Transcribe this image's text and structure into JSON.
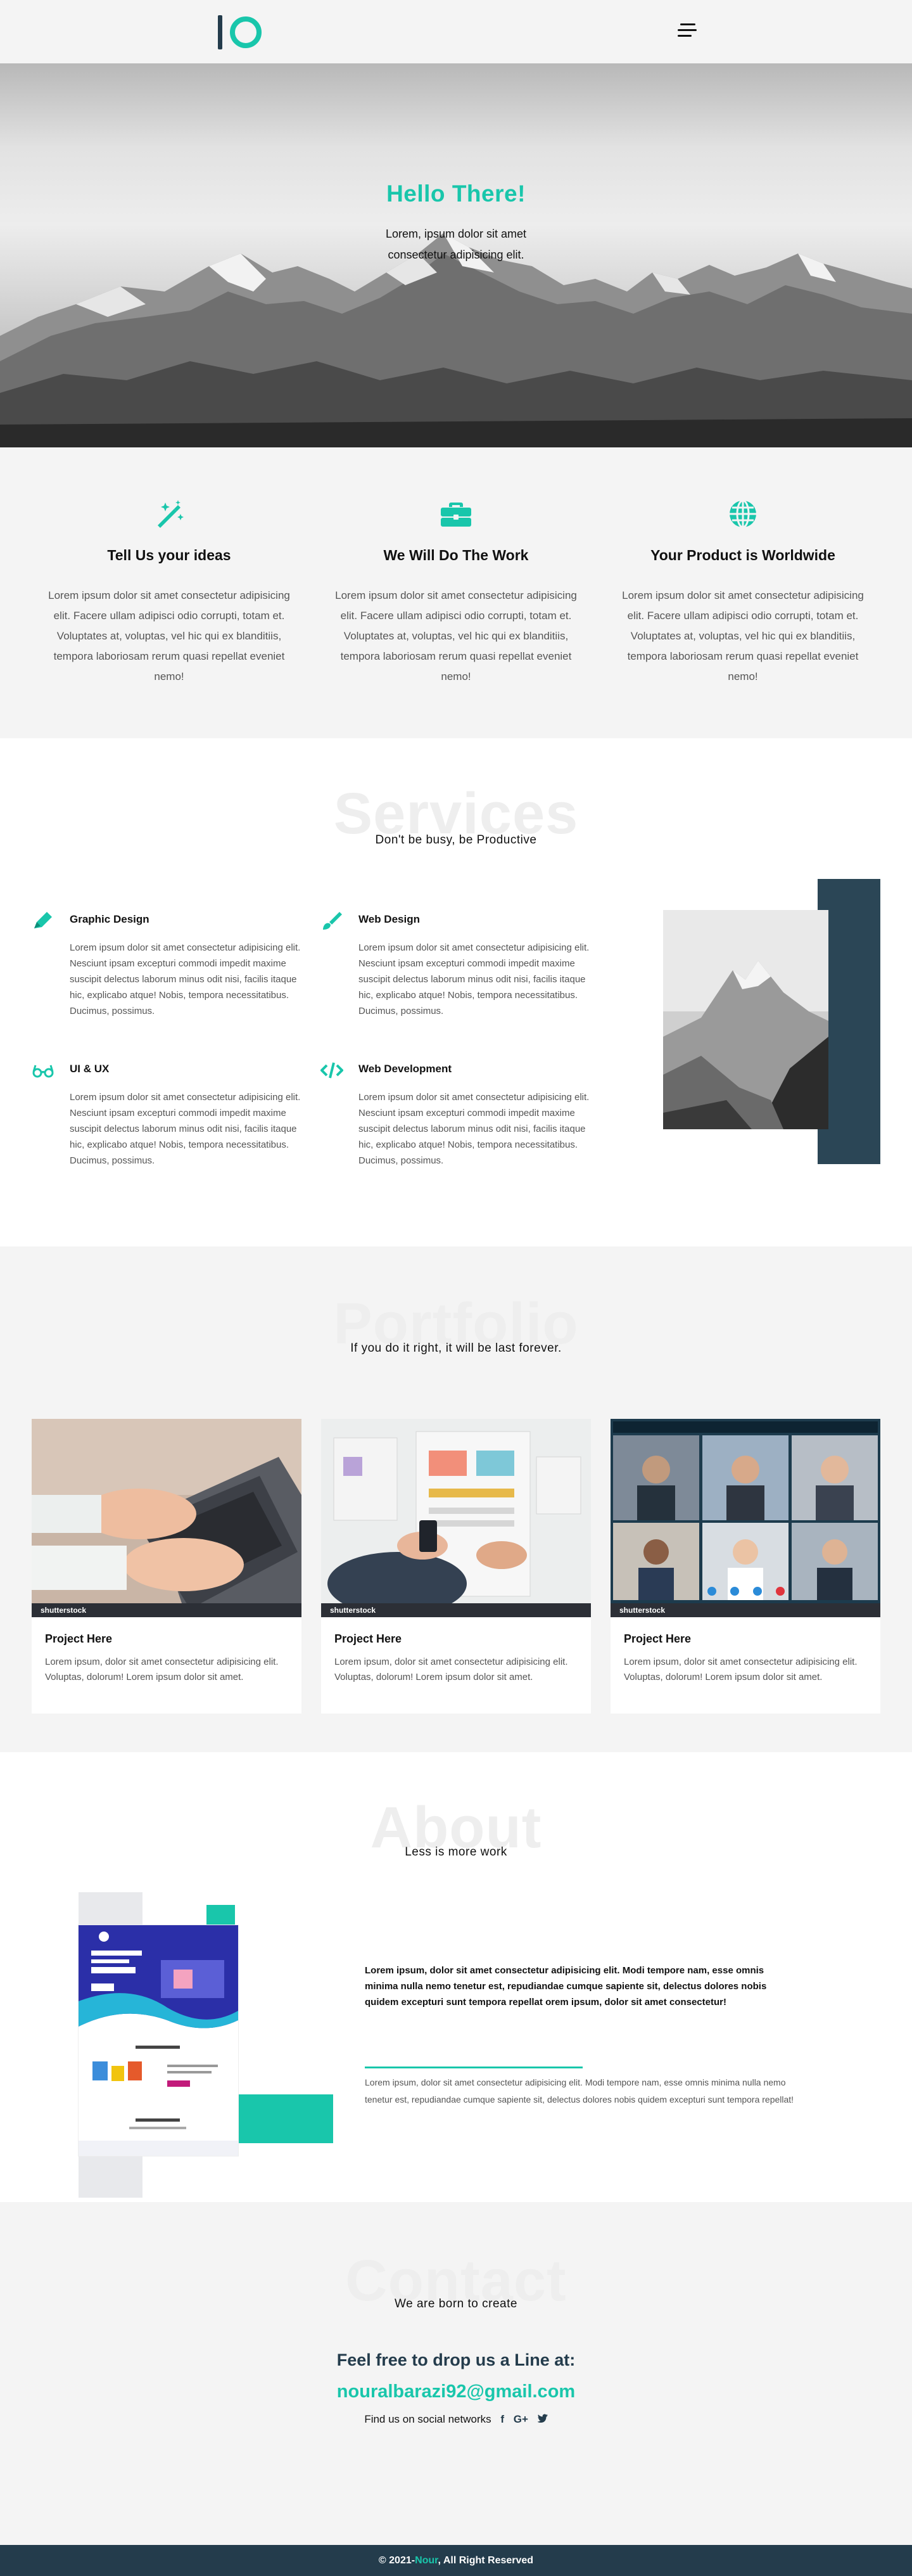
{
  "colors": {
    "accent": "#19c6ab",
    "dark": "#243c4c",
    "light_bg": "#f4f4f4"
  },
  "header": {
    "menu_icon": "hamburger-menu-icon"
  },
  "hero": {
    "title": "Hello There!",
    "subtitle": "Lorem, ipsum dolor sit amet consectetur adipisicing elit."
  },
  "features": [
    {
      "icon": "magic-wand-icon",
      "title": "Tell Us your ideas",
      "text": "Lorem ipsum dolor sit amet consectetur adipisicing elit. Facere ullam adipisci odio corrupti, totam et. Voluptates at, voluptas, vel hic qui ex blanditiis, tempora laboriosam rerum quasi repellat eveniet nemo!"
    },
    {
      "icon": "briefcase-icon",
      "title": "We Will Do The Work",
      "text": "Lorem ipsum dolor sit amet consectetur adipisicing elit. Facere ullam adipisci odio corrupti, totam et. Voluptates at, voluptas, vel hic qui ex blanditiis, tempora laboriosam rerum quasi repellat eveniet nemo!"
    },
    {
      "icon": "globe-icon",
      "title": "Your Product is Worldwide",
      "text": "Lorem ipsum dolor sit amet consectetur adipisicing elit. Facere ullam adipisci odio corrupti, totam et. Voluptates at, voluptas, vel hic qui ex blanditiis, tempora laboriosam rerum quasi repellat eveniet nemo!"
    }
  ],
  "services": {
    "heading": "Services",
    "subtitle": "Don't be busy, be Productive",
    "items": [
      {
        "icon": "pencil-icon",
        "title": "Graphic Design",
        "text": "Lorem ipsum dolor sit amet consectetur adipisicing elit. Nesciunt ipsam excepturi commodi impedit maxime suscipit delectus laborum minus odit nisi, facilis itaque hic, explicabo atque! Nobis, tempora necessitatibus. Ducimus, possimus."
      },
      {
        "icon": "paint-brush-icon",
        "title": "Web Design",
        "text": "Lorem ipsum dolor sit amet consectetur adipisicing elit. Nesciunt ipsam excepturi commodi impedit maxime suscipit delectus laborum minus odit nisi, facilis itaque hic, explicabo atque! Nobis, tempora necessitatibus. Ducimus, possimus."
      },
      {
        "icon": "glasses-icon",
        "title": "UI & UX",
        "text": "Lorem ipsum dolor sit amet consectetur adipisicing elit. Nesciunt ipsam excepturi commodi impedit maxime suscipit delectus laborum minus odit nisi, facilis itaque hic, explicabo atque! Nobis, tempora necessitatibus. Ducimus, possimus."
      },
      {
        "icon": "code-icon",
        "title": "Web Development",
        "text": "Lorem ipsum dolor sit amet consectetur adipisicing elit. Nesciunt ipsam excepturi commodi impedit maxime suscipit delectus laborum minus odit nisi, facilis itaque hic, explicabo atque! Nobis, tempora necessitatibus. Ducimus, possimus."
      }
    ]
  },
  "portfolio": {
    "heading": "Portfolio",
    "subtitle": "If you do it right, it will be last forever.",
    "watermark": "shutterstock",
    "projects": [
      {
        "image": "laptop-typing-photo",
        "title": "Project Here",
        "text": "Lorem ipsum, dolor sit amet consectetur adipisicing elit. Voluptas, dolorum! Lorem ipsum dolor sit amet."
      },
      {
        "image": "ux-wireframe-photo",
        "title": "Project Here",
        "text": "Lorem ipsum, dolor sit amet consectetur adipisicing elit. Voluptas, dolorum! Lorem ipsum dolor sit amet."
      },
      {
        "image": "video-call-photo",
        "title": "Project Here",
        "text": "Lorem ipsum, dolor sit amet consectetur adipisicing elit. Voluptas, dolorum! Lorem ipsum dolor sit amet."
      }
    ]
  },
  "about": {
    "heading": "About",
    "subtitle": "Less is more work",
    "bold_text": "Lorem ipsum, dolor sit amet consectetur adipisicing elit. Modi tempore nam, esse omnis minima nulla nemo tenetur est, repudiandae cumque sapiente sit, delectus dolores nobis quidem excepturi sunt tempora repellat orem ipsum, dolor sit amet consectetur!",
    "text": "Lorem ipsum, dolor sit amet consectetur adipisicing elit. Modi tempore nam, esse omnis minima nulla nemo tenetur est, repudiandae cumque sapiente sit, delectus dolores nobis quidem excepturi sunt tempora repellat!"
  },
  "contact": {
    "heading": "Contact",
    "subtitle": "We are born to create",
    "drop_line": "Feel free to drop us a Line at:",
    "email": "nouralbarazi92@gmail.com",
    "social_label": "Find us on social networks",
    "social": [
      {
        "icon": "facebook-icon",
        "glyph": "f"
      },
      {
        "icon": "google-plus-icon",
        "glyph": "G+"
      },
      {
        "icon": "twitter-icon",
        "glyph": "t"
      }
    ]
  },
  "footer": {
    "prefix": "© 2021-",
    "brand": "Nour",
    "suffix": ", All Right Reserved"
  }
}
